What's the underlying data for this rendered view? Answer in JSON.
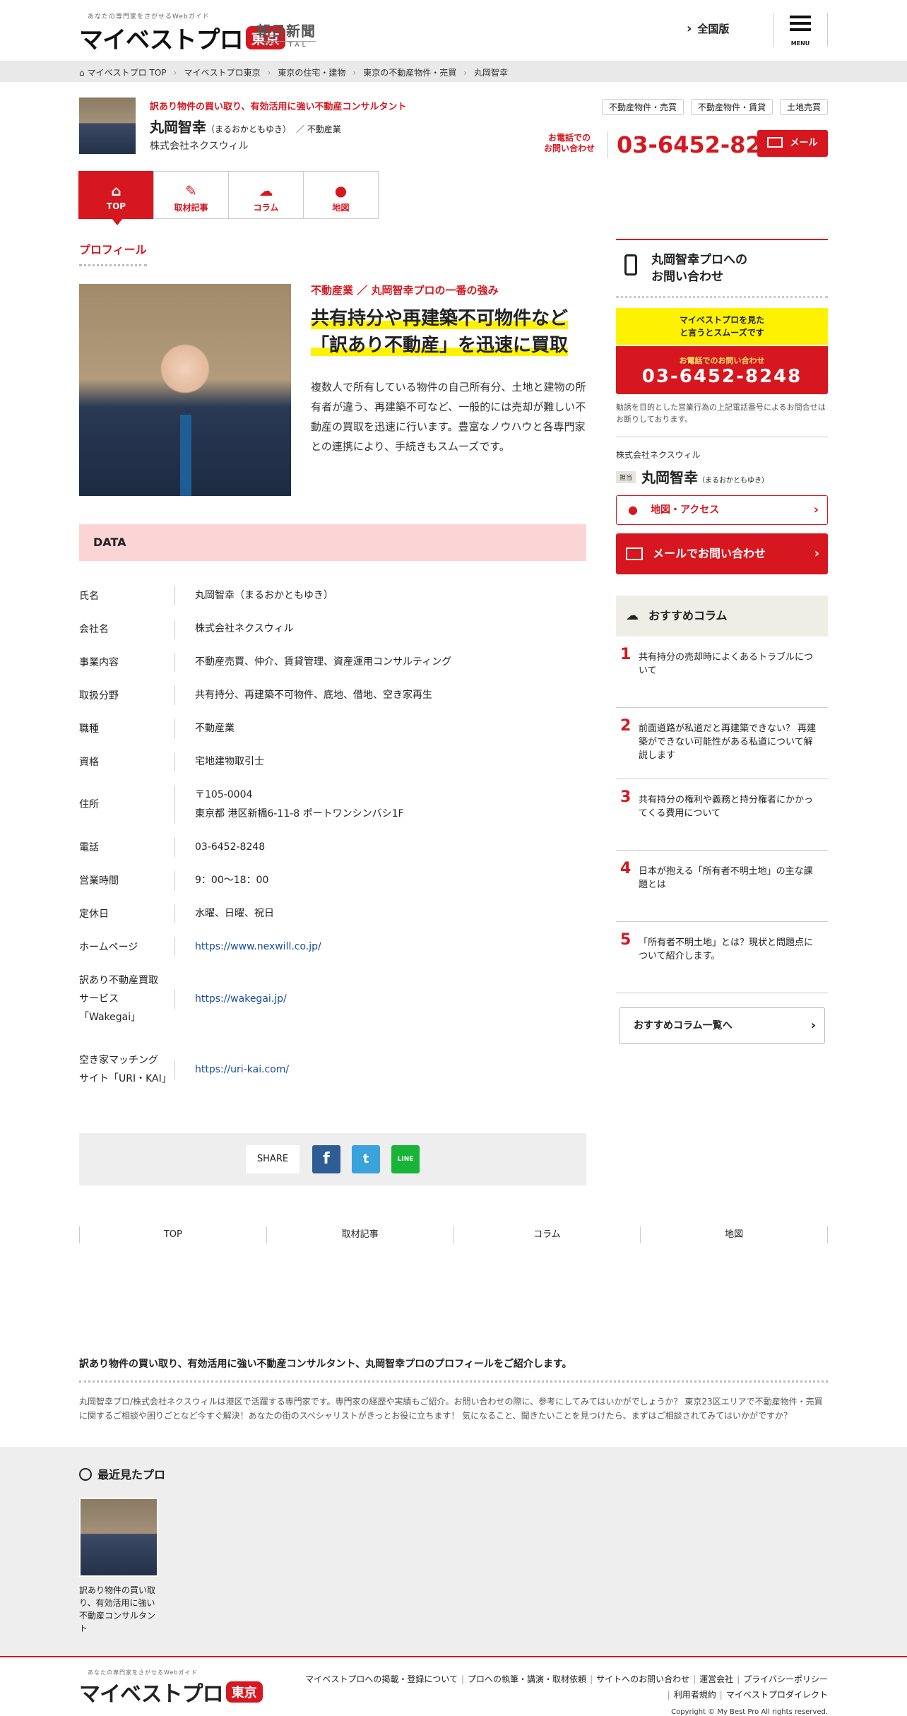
{
  "header": {
    "logo_tagline": "あなたの専門家をさがせるWebガイド",
    "logo_text": "マイベストプロ",
    "logo_badge": "東京",
    "partner_name": "朝日新聞",
    "partner_sub": "DIGITAL",
    "national_link": "全国版",
    "menu_label": "MENU"
  },
  "breadcrumb": [
    "マイベストプロ TOP",
    "マイベストプロ東京",
    "東京の住宅・建物",
    "東京の不動産物件・売買",
    "丸岡智幸"
  ],
  "profile_head": {
    "tagline": "訳あり物件の買い取り、有効活用に強い不動産コンサルタント",
    "name": "丸岡智幸",
    "name_reading": "（まるおかともゆき）",
    "occupation": "／ 不動産業",
    "company": "株式会社ネクスウィル",
    "categories": [
      "不動産物件・売買",
      "不動産物件・賃貸",
      "土地売買"
    ],
    "tel_label_1": "お電話での",
    "tel_label_2": "お問い合わせ",
    "tel_number": "03-6452-8248",
    "mail_label": "メール"
  },
  "tabs": [
    {
      "label": "TOP",
      "icon": "home-icon",
      "glyph": "⌂",
      "active": true
    },
    {
      "label": "取材記事",
      "icon": "pencil-icon",
      "glyph": "✎",
      "active": false
    },
    {
      "label": "コラム",
      "icon": "chat-icon",
      "glyph": "☁",
      "active": false
    },
    {
      "label": "地図",
      "icon": "map-pin-icon",
      "glyph": "●",
      "active": false
    }
  ],
  "profile": {
    "section_title": "プロフィール",
    "strength_label": "不動産業 ／ 丸岡智幸プロの一番の強み",
    "strength_title_1": "共有持分や再建築不可物件など",
    "strength_title_2": "「訳あり不動産」を迅速に買取",
    "strength_body": "複数人で所有している物件の自己所有分、土地と建物の所有者が違う、再建築不可など、一般的には売却が難しい不動産の買取を迅速に行います。豊富なノウハウと各専門家との連携により、手続きもスムーズです。"
  },
  "data": {
    "heading": "DATA",
    "rows": [
      {
        "label": "氏名",
        "value": "丸岡智幸（まるおかともゆき）"
      },
      {
        "label": "会社名",
        "value": "株式会社ネクスウィル"
      },
      {
        "label": "事業内容",
        "value": "不動産売買、仲介、賃貸管理、資産運用コンサルティング"
      },
      {
        "label": "取扱分野",
        "value": "共有持分、再建築不可物件、底地、借地、空き家再生"
      },
      {
        "label": "職種",
        "value": "不動産業"
      },
      {
        "label": "資格",
        "value": "宅地建物取引士"
      },
      {
        "label": "住所",
        "value": "〒105-0004",
        "value2": "東京都 港区新橋6-11-8 ポートワンシンバシ1F"
      },
      {
        "label": "電話",
        "value": "03-6452-8248"
      },
      {
        "label": "営業時間",
        "value": "9：00〜18：00"
      },
      {
        "label": "定休日",
        "value": "水曜、日曜、祝日"
      },
      {
        "label": "ホームページ",
        "value": "https://www.nexwill.co.jp/"
      },
      {
        "label": "訳あり不動産買取サービス「Wakegai」",
        "value": "https://wakegai.jp/"
      },
      {
        "label": "空き家マッチングサイト「URI・KAI」",
        "value": "https://uri-kai.com/"
      }
    ]
  },
  "share": {
    "label": "SHARE",
    "facebook": "f",
    "twitter": "t",
    "line": "LINE"
  },
  "footer_tabs": [
    "TOP",
    "取材記事",
    "コラム",
    "地図"
  ],
  "sidebar": {
    "contact_title_1": "丸岡智幸プロへの",
    "contact_title_2": "お問い合わせ",
    "yellow_1": "マイベストプロを見た",
    "yellow_2": "と言うとスムーズです",
    "tel_label": "お電話でのお問い合わせ",
    "tel_number": "03-6452-8248",
    "notice": "勧誘を目的とした営業行為の上記電話番号によるお問合せはお断りしております。",
    "company": "株式会社ネクスウィル",
    "name_tag": "担当",
    "name": "丸岡智幸",
    "name_reading": "（まるおかともゆき）",
    "map_label": "地図・アクセス",
    "mail_label": "メールでお問い合わせ",
    "column_heading": "おすすめコラム",
    "columns": [
      {
        "num": "1",
        "title": "共有持分の売却時によくあるトラブルについて"
      },
      {
        "num": "2",
        "title": "前面道路が私道だと再建築できない？ 再建築ができない可能性がある私道について解説します"
      },
      {
        "num": "3",
        "title": "共有持分の権利や義務と持分権者にかかってくる費用について"
      },
      {
        "num": "4",
        "title": "日本が抱える「所有者不明土地」の主な課題とは"
      },
      {
        "num": "5",
        "title": "「所有者不明土地」とは？現状と問題点について紹介します。"
      }
    ],
    "column_all": "おすすめコラム一覧へ"
  },
  "intro": {
    "title": "訳あり物件の買い取り、有効活用に強い不動産コンサルタント、丸岡智幸プロのプロフィールをご紹介します。",
    "body": "丸岡智幸プロ/株式会社ネクスウィルは港区で活躍する専門家です。専門家の経歴や実績もご紹介。お問い合わせの際に、参考にしてみてはいかがでしょうか？ 東京23区エリアで不動産物件・売買に関するご相談や困りごとなど今すぐ解決！あなたの街のスペシャリストがきっとお役に立ちます！ 気になること、聞きたいことを見つけたら、まずはご相談されてみてはいかがですか？"
  },
  "recent": {
    "title": "最近見たプロ",
    "caption": "訳あり物件の買い取り、有効活用に強い不動産コンサルタント"
  },
  "footer": {
    "links": [
      "マイベストプロへの掲載・登録について",
      "プロへの執筆・講演・取材依頼",
      "サイトへのお問い合わせ",
      "運営会社",
      "プライバシーポリシー",
      "利用者規約",
      "マイベストプロダイレクト"
    ],
    "copyright": "Copyright © My Best Pro All rights reserved."
  }
}
